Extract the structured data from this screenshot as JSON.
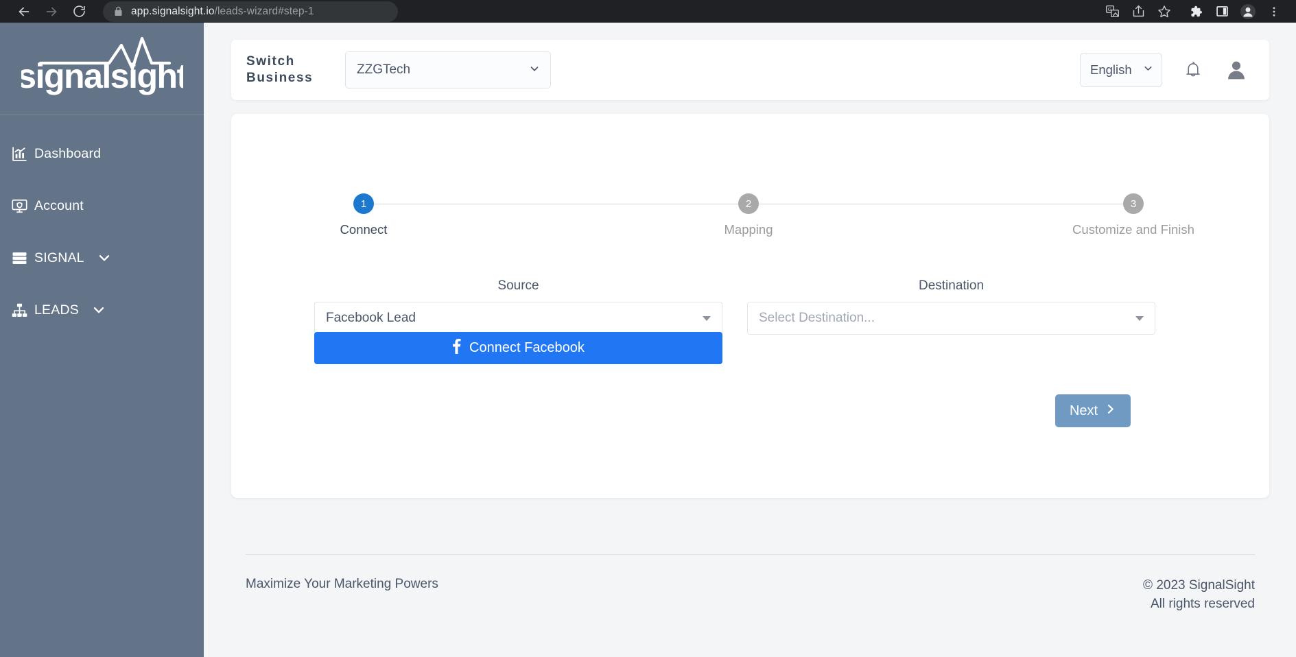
{
  "browser": {
    "url_domain": "app.signalsight.io",
    "url_path": "/leads-wizard#step-1",
    "back_icon": "back-arrow-icon",
    "forward_icon": "forward-arrow-icon",
    "reload_icon": "reload-icon",
    "lock_icon": "lock-icon",
    "toolbar_icons": [
      "translate-icon",
      "share-icon",
      "bookmark-star-icon",
      "extensions-puzzle-icon",
      "side-panel-icon",
      "profile-avatar-icon",
      "browser-menu-icon"
    ]
  },
  "sidebar": {
    "brand": "signalsight",
    "brand_icon": "signal-pulse-icon",
    "items": [
      {
        "label": "Dashboard",
        "icon": "chart-bars-icon",
        "chevron": false
      },
      {
        "label": "Account",
        "icon": "monitor-shield-icon",
        "chevron": false
      },
      {
        "label": "SIGNAL",
        "icon": "server-stack-icon",
        "chevron": true
      },
      {
        "label": "LEADS",
        "icon": "sitemap-icon",
        "chevron": true
      }
    ]
  },
  "header": {
    "switch_label": "Switch Business",
    "business_value": "ZZGTech",
    "language_value": "English",
    "bell_icon": "notification-bell-icon",
    "avatar_icon": "user-avatar-icon",
    "chevron_icon": "chevron-down-icon"
  },
  "wizard": {
    "steps": [
      {
        "number": "1",
        "label": "Connect",
        "state": "active"
      },
      {
        "number": "2",
        "label": "Mapping",
        "state": "idle"
      },
      {
        "number": "3",
        "label": "Customize and Finish",
        "state": "idle"
      }
    ],
    "source": {
      "label": "Source",
      "value": "Facebook Lead",
      "caret_icon": "caret-down-icon"
    },
    "destination": {
      "label": "Destination",
      "placeholder": "Select Destination...",
      "caret_icon": "caret-down-icon"
    },
    "connect_button": {
      "label": "Connect Facebook",
      "icon": "facebook-f-icon"
    },
    "next_button": {
      "label": "Next",
      "icon": "chevron-right-icon"
    }
  },
  "footer": {
    "tagline": "Maximize Your Marketing Powers",
    "copyright": "© 2023 SignalSight",
    "rights": "All rights reserved"
  },
  "colors": {
    "sidebar_bg": "#637488",
    "page_bg": "#f4f5f7",
    "accent_active_step": "#1d79d0",
    "idle_step": "#a9a9a9",
    "facebook_blue": "#2176f3",
    "next_button": "#709ac2",
    "browser_chrome": "#202124"
  }
}
